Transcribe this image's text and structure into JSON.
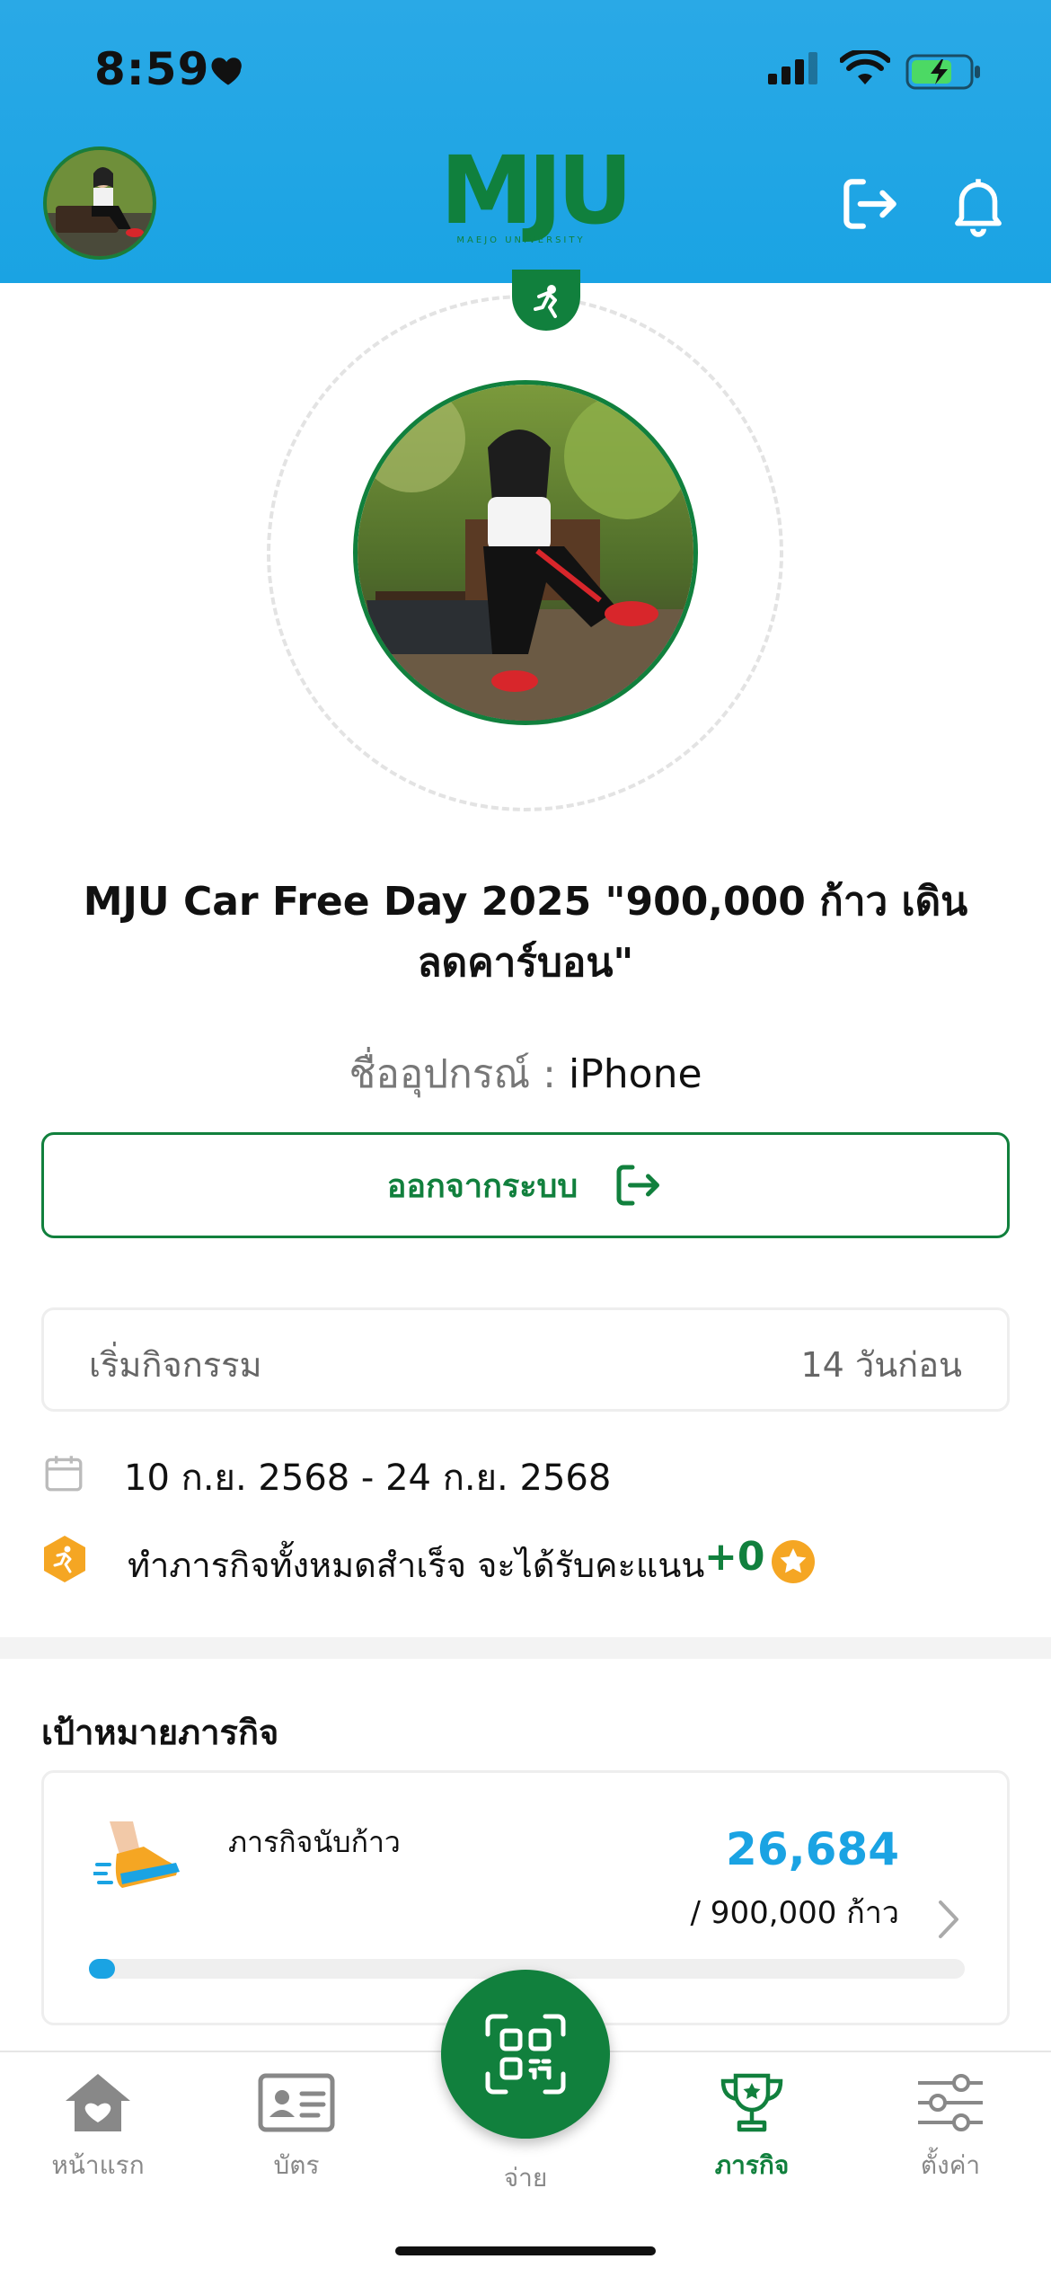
{
  "status_bar": {
    "time": "8:59"
  },
  "header": {
    "logo_text": "MJU",
    "logo_sub": "MAEJO UNIVERSITY"
  },
  "activity": {
    "title": "MJU Car Free Day 2025 \"900,000 ก้าว เดินลดคาร์บอน\"",
    "device_label": "ชื่ออุปกรณ์ :",
    "device_value": "iPhone",
    "logout_label": "ออกจากระบบ",
    "start_label": "เริ่มกิจกรรม",
    "start_ago": "14 วันก่อน",
    "date_range": "10 ก.ย. 2568 - 24 ก.ย. 2568",
    "reward_text": "ทำภารกิจทั้งหมดสำเร็จ จะได้รับคะแนน",
    "reward_points": "+0"
  },
  "missions": {
    "section_title": "เป้าหมายภารกิจ",
    "items": [
      {
        "name": "ภารกิจนับก้าว",
        "value": "26,684",
        "goal": "/ 900,000 ก้าว",
        "progress": 0.0296
      }
    ]
  },
  "tabbar": {
    "items": [
      {
        "label": "หน้าแรก",
        "icon": "home-heart-icon"
      },
      {
        "label": "บัตร",
        "icon": "id-card-icon"
      },
      {
        "label": "จ่าย",
        "icon": "qr-scan-icon"
      },
      {
        "label": "ภารกิจ",
        "icon": "trophy-icon"
      },
      {
        "label": "ตั้งค่า",
        "icon": "sliders-icon"
      }
    ],
    "active": "ภารกิจ"
  },
  "colors": {
    "primary_green": "#11803d",
    "header_blue": "#1aa3e3",
    "steps_blue": "#1aa3e3",
    "reward_orange": "#f5a623"
  }
}
